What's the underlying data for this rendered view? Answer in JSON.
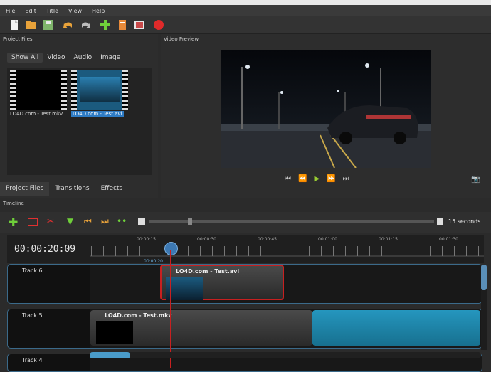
{
  "menu": [
    "File",
    "Edit",
    "Title",
    "View",
    "Help"
  ],
  "toolbar_icons": [
    "new-project-icon",
    "open-project-icon",
    "save-project-icon",
    "undo-icon",
    "redo-icon",
    "import-files-icon",
    "profile-icon",
    "fullscreen-icon",
    "export-video-icon"
  ],
  "panels": {
    "project_files": "Project Files",
    "video_preview": "Video Preview",
    "timeline": "Timeline"
  },
  "filters": [
    "Show All",
    "Video",
    "Audio",
    "Image"
  ],
  "files": [
    {
      "label": "LO4D.com - Test.mkv",
      "selected": false
    },
    {
      "label": "LO4D.com - Test.avi",
      "selected": true
    }
  ],
  "bottom_tabs": [
    "Project Files",
    "Transitions",
    "Effects"
  ],
  "timeline": {
    "timecode": "00:00:20:09",
    "zoom_label": "15 seconds",
    "ticks": [
      "00:00:15",
      "00:00:30",
      "00:00:45",
      "00:01:00",
      "00:01:15",
      "00:01:30"
    ],
    "marker_text": "00:00:20"
  },
  "tracks": [
    {
      "name": "Track 6",
      "clip": "LO4D.com - Test.avi"
    },
    {
      "name": "Track 5",
      "clip": "LO4D.com - Test.mkv"
    },
    {
      "name": "Track 4"
    }
  ],
  "colors": {
    "accent": "#4a9bc8",
    "selection": "#c82020",
    "clip_cyan": "#1f8fb0"
  }
}
